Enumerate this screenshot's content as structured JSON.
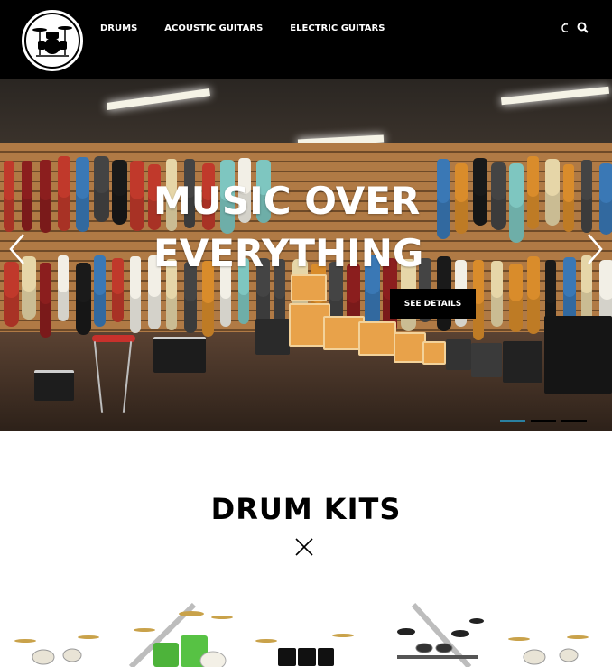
{
  "header": {
    "nav": [
      "DRUMS",
      "ACOUSTIC GUITARS",
      "ELECTRIC GUITARS"
    ],
    "icons": [
      "cart-icon",
      "search-icon"
    ]
  },
  "hero": {
    "title": "MUSIC OVER EVERYTHING",
    "cta_label": "SEE DETAILS",
    "slides": 3,
    "active_slide": 1
  },
  "section": {
    "title": "DRUM KITS"
  },
  "colors": {
    "header_bg": "#000000",
    "accent": "#2a7fa0",
    "text": "#000000"
  }
}
